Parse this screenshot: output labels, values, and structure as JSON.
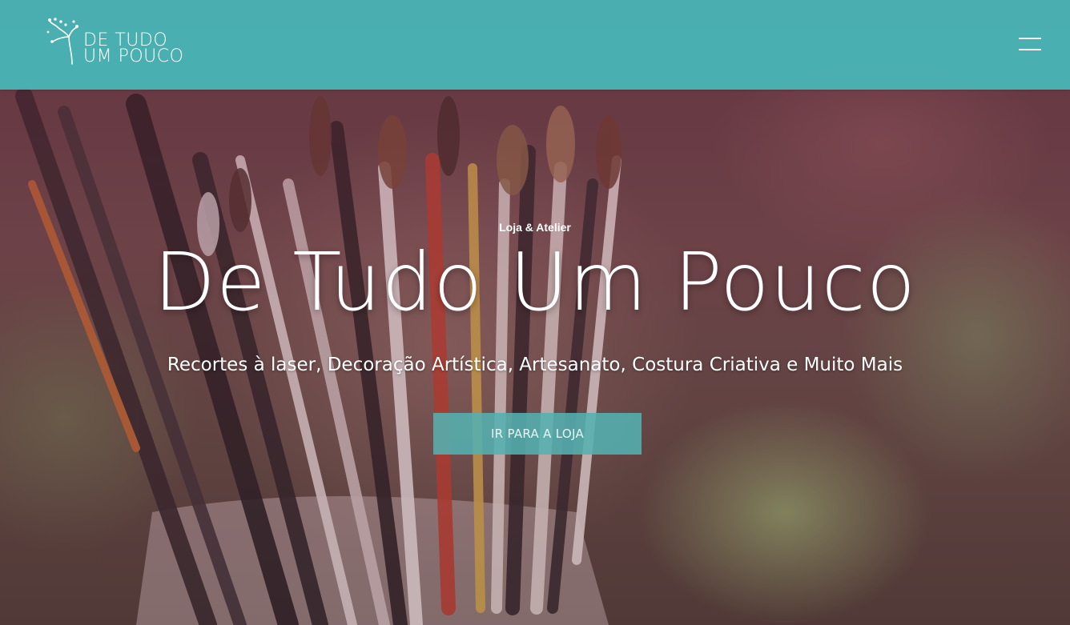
{
  "brand": {
    "line1": "DE TUDO",
    "line2": "UM POUCO",
    "header_color": "#48b8b9"
  },
  "header": {
    "menu_icon": "hamburger-menu-icon"
  },
  "hero": {
    "eyebrow": "Loja & Atelier",
    "title": "De Tudo Um Pouco",
    "subtitle": "Recortes à laser, Decoração Artística, Artesanato, Costura Criativa e Muito Mais",
    "cta_label": "IR PARA A LOJA",
    "cta_color": "#54b1b0"
  }
}
